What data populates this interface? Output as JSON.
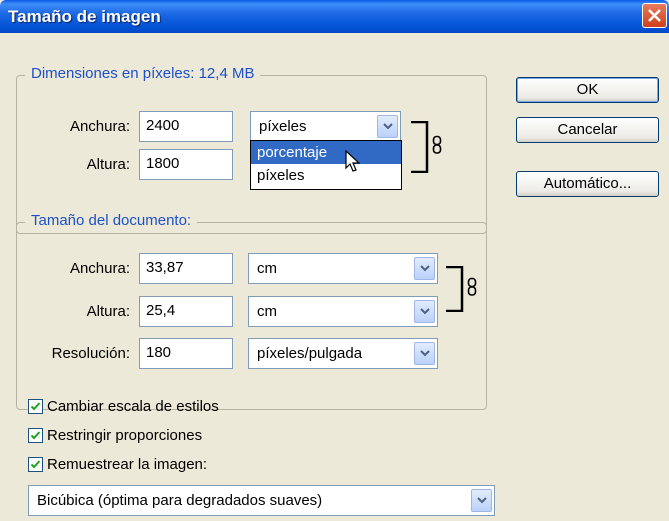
{
  "title": "Tamaño de imagen",
  "pixel_dimensions": {
    "legend": "Dimensiones en píxeles: 12,4 MB",
    "width_label": "Anchura:",
    "width_value": "2400",
    "width_unit": "píxeles",
    "height_label": "Altura:",
    "height_value": "1800",
    "height_unit_options": [
      "porcentaje",
      "píxeles"
    ],
    "highlighted_option": "porcentaje"
  },
  "document_size": {
    "legend": "Tamaño del documento:",
    "width_label": "Anchura:",
    "width_value": "33,87",
    "width_unit": "cm",
    "height_label": "Altura:",
    "height_value": "25,4",
    "height_unit": "cm",
    "resolution_label": "Resolución:",
    "resolution_value": "180",
    "resolution_unit": "píxeles/pulgada"
  },
  "buttons": {
    "ok": "OK",
    "cancel": "Cancelar",
    "auto": "Automático..."
  },
  "checkboxes": {
    "scale_styles": "Cambiar escala de estilos",
    "constrain": "Restringir proporciones",
    "resample": "Remuestrear la imagen:"
  },
  "resample_method": "Bicúbica (óptima para degradados suaves)",
  "colors": {
    "title_bar": "#0a5ce8",
    "legend_text": "#1e50c8",
    "dialog_bg": "#ece9d8",
    "highlight": "#316ac5"
  }
}
